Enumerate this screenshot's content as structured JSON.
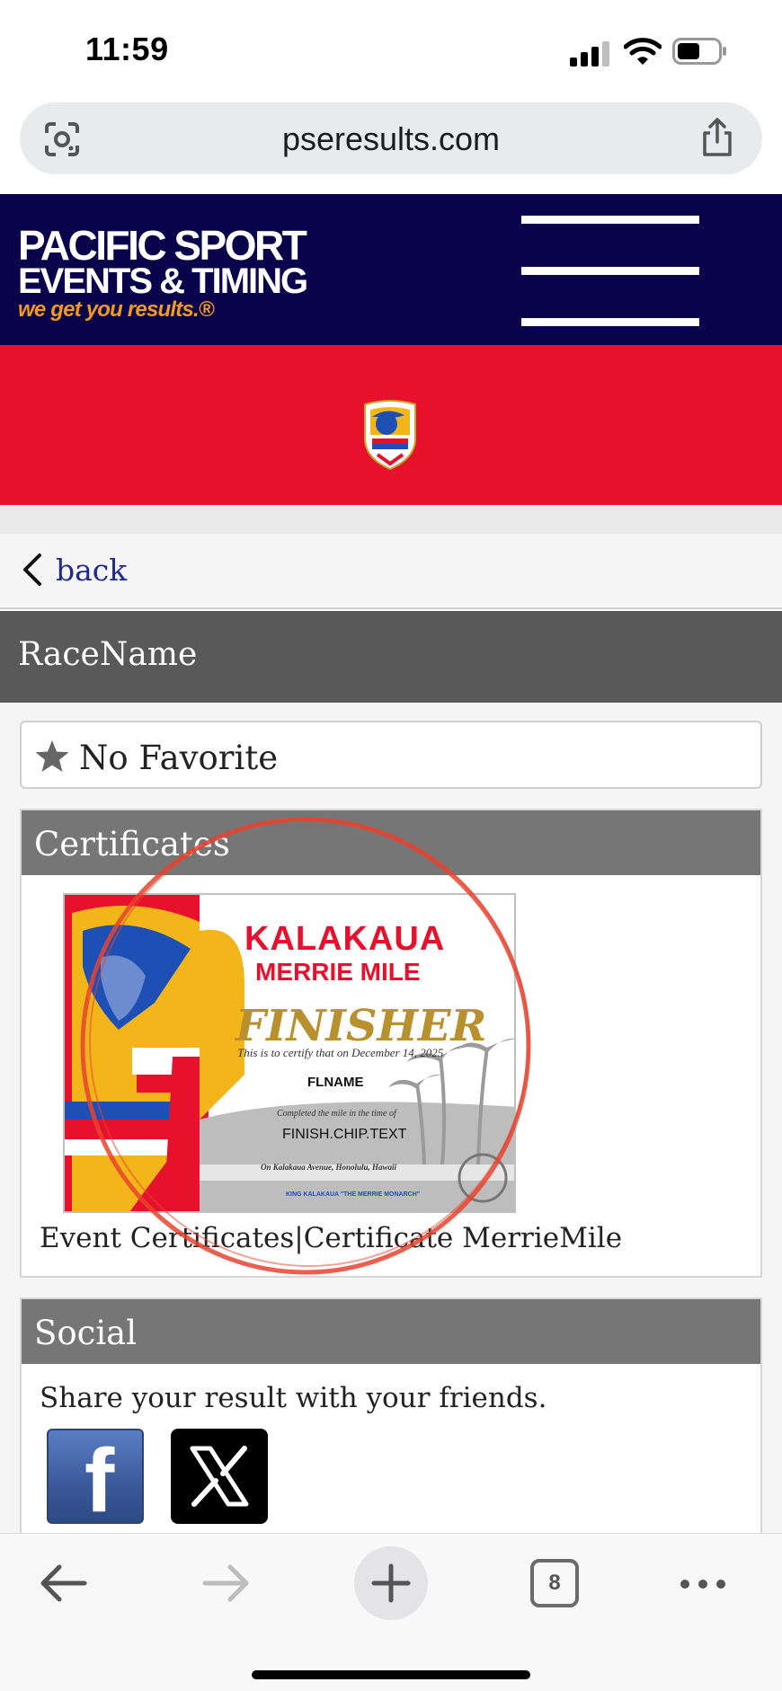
{
  "status_bar": {
    "time": "11:59"
  },
  "browser": {
    "url": "pseresults.com",
    "open_tabs": "8"
  },
  "header": {
    "logo_line1": "PACIFIC SPORT",
    "logo_line2": "EVENTS & TIMING",
    "logo_tagline": "we get you results.®"
  },
  "nav": {
    "back_label": "back"
  },
  "race": {
    "name": "RaceName"
  },
  "favorite": {
    "label": "No Favorite"
  },
  "certificates": {
    "title": "Certificates",
    "caption": "Event Certificates|Certificate MerrieMile",
    "image": {
      "event_line1": "KALAKAUA",
      "event_line2": "MERRIE MILE",
      "heading": "FINISHER",
      "certify_text": "This is to certify that on December 14, 2025",
      "name": "FLNAME",
      "completed_text": "Completed the mile in the time of",
      "time": "FINISH.CHIP.TEXT",
      "location": "On Kalakaua Avenue, Honolulu, Hawaii",
      "footer": "KING KALAKAUA \"THE MERRIE MONARCH\""
    }
  },
  "social": {
    "title": "Social",
    "text": "Share your result with your friends."
  },
  "colors": {
    "header_navy": "#08034a",
    "banner_red": "#e8112d",
    "tagline_orange": "#f29a1f",
    "panel_gray": "#767676",
    "race_bar_gray": "#595959",
    "back_link_blue": "#1f2a8a"
  }
}
